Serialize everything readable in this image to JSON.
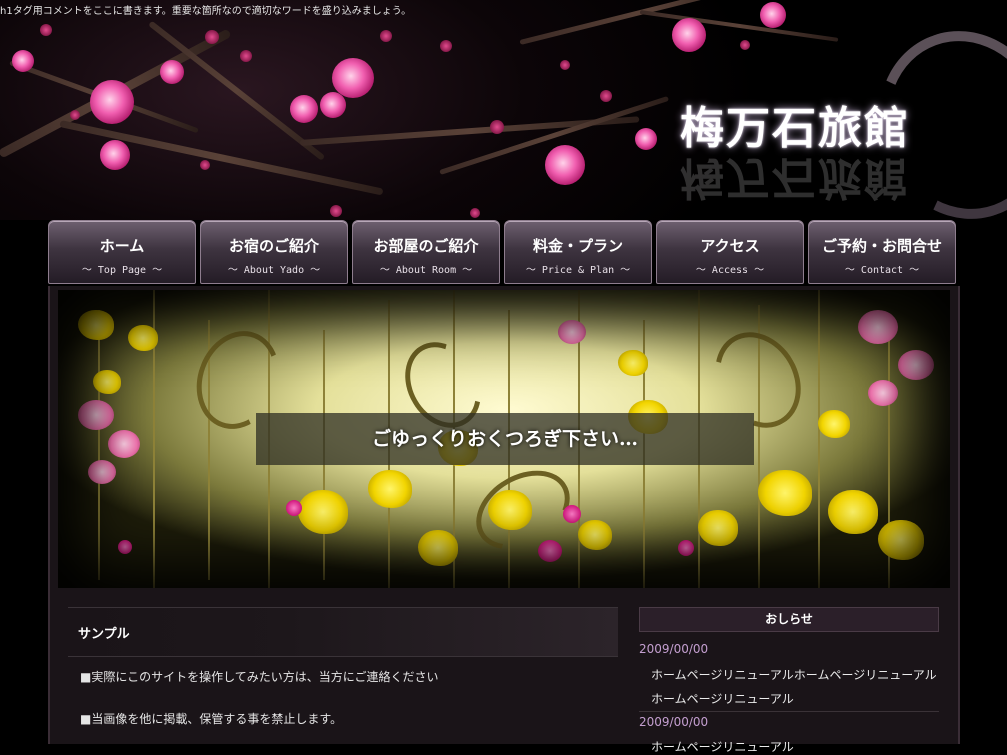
{
  "header": {
    "h1_text": "h1タグ用コメントをここに書きます。重要な箇所なので適切なワードを盛り込みましょう。",
    "logo": "梅万石旅館"
  },
  "nav": [
    {
      "jp": "ホーム",
      "en": "～ Top Page ～"
    },
    {
      "jp": "お宿のご紹介",
      "en": "～ About Yado ～"
    },
    {
      "jp": "お部屋のご紹介",
      "en": "～ About Room ～"
    },
    {
      "jp": "料金・プラン",
      "en": "～ Price & Plan ～"
    },
    {
      "jp": "アクセス",
      "en": "～ Access ～"
    },
    {
      "jp": "ご予約・お問合せ",
      "en": "～ Contact ～"
    }
  ],
  "main_visual": {
    "caption": "ごゆっくりおくつろぎ下さい…"
  },
  "content": {
    "title": "サンプル",
    "paragraphs": [
      "■実際にこのサイトを操作してみたい方は、当方にご連絡ください",
      "■当画像を他に掲載、保管する事を禁止します。"
    ]
  },
  "news": {
    "title": "おしらせ",
    "items": [
      {
        "date": "2009/00/00",
        "lines": [
          "ホームページリニューアルホームページリニューアル",
          "ホームページリニューアル"
        ]
      },
      {
        "date": "2009/00/00",
        "lines": [
          "ホームページリニューアル"
        ]
      }
    ]
  }
}
